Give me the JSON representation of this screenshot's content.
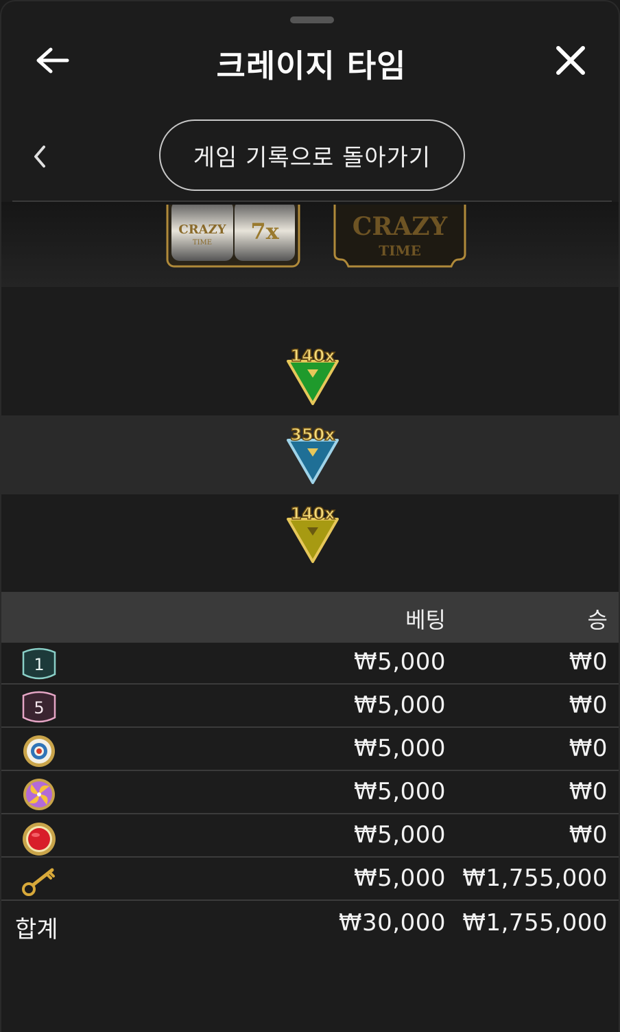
{
  "header": {
    "title": "크레이지 타임"
  },
  "subnav": {
    "history_button_label": "게임 기록으로 돌아가기"
  },
  "result": {
    "reel_multiplier": "7x",
    "reel_logo_text": "CRAZY TIME",
    "badge_text_top": "CRAZY",
    "badge_text_bottom": "TIME"
  },
  "wheels": [
    {
      "multiplier": "140x",
      "color": "#1f9a2c"
    },
    {
      "multiplier": "350x",
      "color": "#1f6f96"
    },
    {
      "multiplier": "140x",
      "color": "#a79a12"
    }
  ],
  "table": {
    "col_bet": "베팅",
    "col_win": "승",
    "rows": [
      {
        "icon": "number-1-icon",
        "icon_text": "1",
        "bet": "₩5,000",
        "win": "₩0"
      },
      {
        "icon": "number-5-icon",
        "icon_text": "5",
        "bet": "₩5,000",
        "win": "₩0"
      },
      {
        "icon": "coin-flip-target-icon",
        "bet": "₩5,000",
        "win": "₩0"
      },
      {
        "icon": "pachinko-candy-icon",
        "bet": "₩5,000",
        "win": "₩0"
      },
      {
        "icon": "crazy-time-red-button-icon",
        "bet": "₩5,000",
        "win": "₩0"
      },
      {
        "icon": "cash-hunt-key-icon",
        "bet": "₩5,000",
        "win": "₩1,755,000"
      }
    ],
    "total_label": "합계",
    "total_bet": "₩30,000",
    "total_win": "₩1,755,000"
  },
  "colors": {
    "background": "#1c1c1c",
    "table_header": "#3a3a3a",
    "gold": "#c9a44a"
  }
}
